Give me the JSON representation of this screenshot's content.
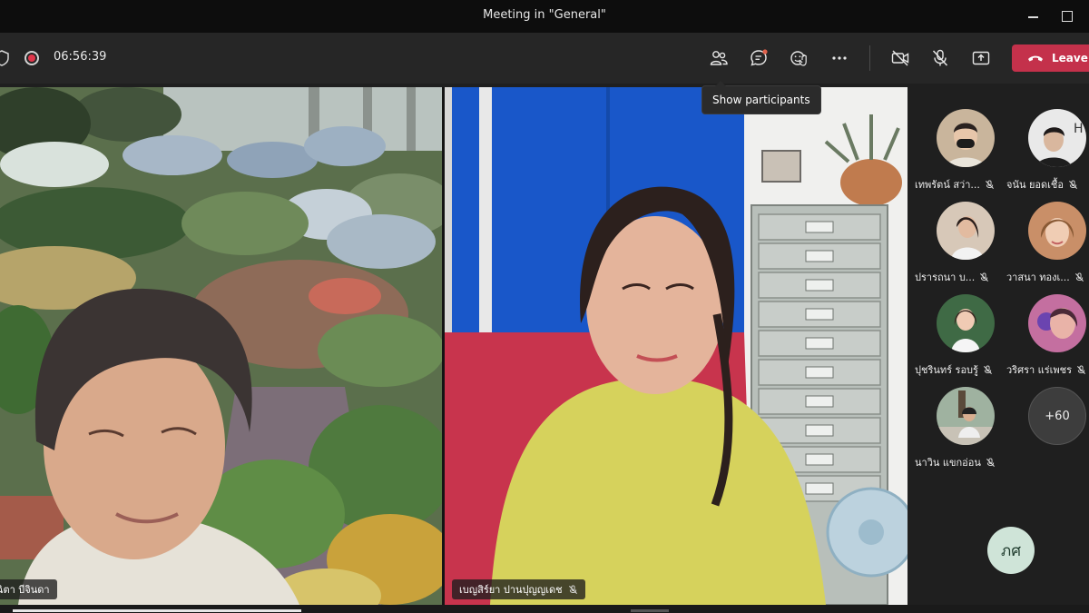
{
  "window": {
    "title": "Meeting in \"General\""
  },
  "toolbar": {
    "timer": "06:56:39",
    "leave_label": "Leave"
  },
  "tooltip": {
    "text": "Show participants"
  },
  "stage": {
    "left_name": "ฉิตา บีจินดา",
    "right_name": "เบญสิร์ยา ปานปุญญเดช"
  },
  "participants": [
    {
      "name": "เทพรัตน์ สว่า..."
    },
    {
      "name": "จนัน ยอดเชื้อ"
    },
    {
      "name": "ปรารถนา บ..."
    },
    {
      "name": "วาสนา ทองเ..."
    },
    {
      "name": "ปุชรินทร์ รอบรู้"
    },
    {
      "name": "วริศรา แร่เพชร"
    },
    {
      "name": "นาวิน แขกอ่อน"
    }
  ],
  "more_count": "+60",
  "self": {
    "initials": "ภศ"
  },
  "colors": {
    "leave": "#c4314b",
    "recording": "#e0374b",
    "self_avatar": "#cfe4d8"
  }
}
